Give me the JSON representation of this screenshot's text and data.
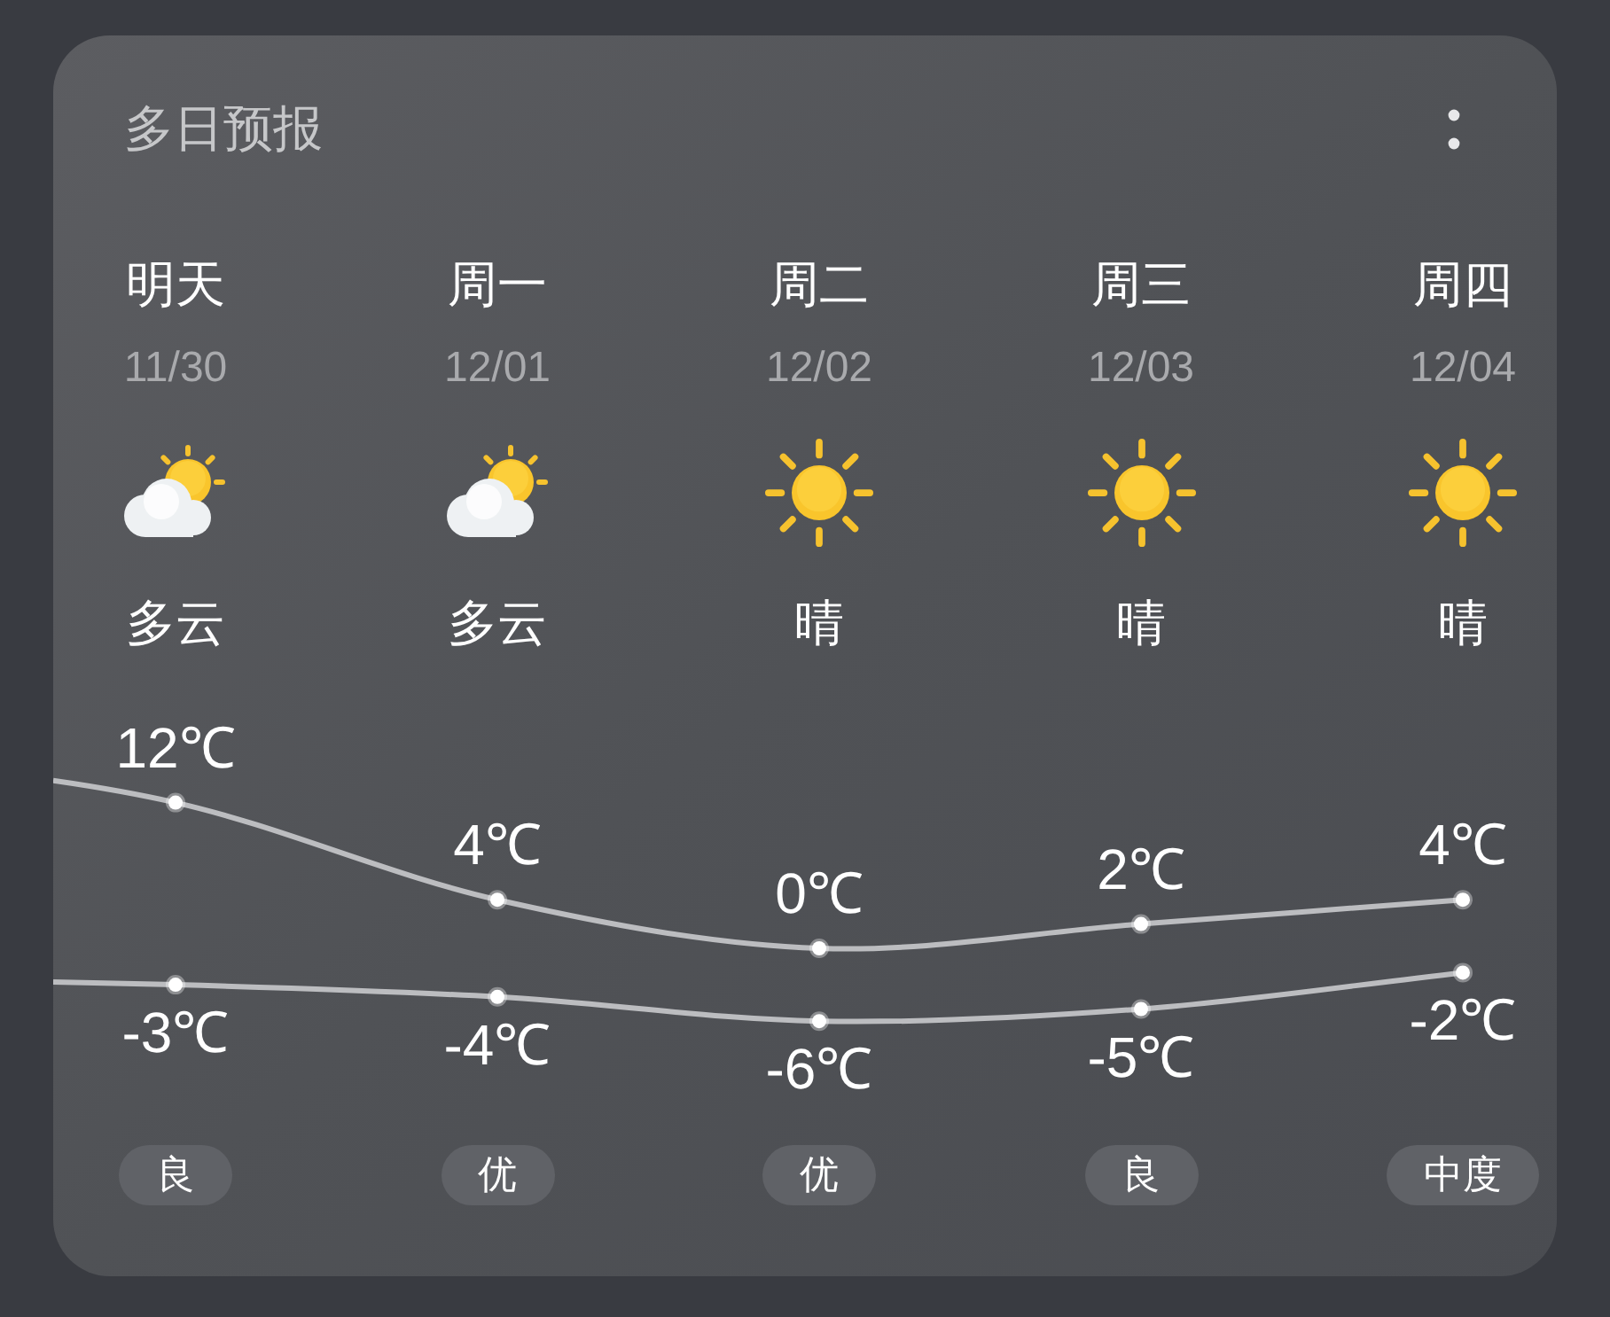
{
  "title": "多日预报",
  "days": [
    {
      "date": "11/30",
      "kind": "cloudy",
      "condition": "多云",
      "aqi": "良"
    },
    {
      "date": "12/01",
      "kind": "cloudy",
      "condition": "多云",
      "aqi": "优"
    },
    {
      "date": "12/02",
      "kind": "sunny",
      "condition": "晴",
      "aqi": "优"
    },
    {
      "date": "12/03",
      "kind": "sunny",
      "condition": "晴",
      "aqi": "良"
    },
    {
      "date": "12/04",
      "kind": "sunny",
      "condition": "晴",
      "aqi": "中度"
    }
  ],
  "chart_data": {
    "type": "line",
    "categories": [
      "明天",
      "周一",
      "周二",
      "周三",
      "周四"
    ],
    "series": [
      {
        "color": "#bcbdc0",
        "marker": "o",
        "values": [
          12,
          4,
          0,
          2,
          4
        ],
        "value_labels": [
          "12℃",
          "4℃",
          "0℃",
          "2℃",
          "4℃"
        ]
      },
      {
        "color": "#bcbdc0",
        "marker": "o",
        "values": [
          -3,
          -4,
          -6,
          -5,
          -2
        ],
        "value_labels": [
          "-3℃",
          "-4℃",
          "-6℃",
          "-5℃",
          "-2℃"
        ]
      }
    ],
    "data_labels": true
  }
}
